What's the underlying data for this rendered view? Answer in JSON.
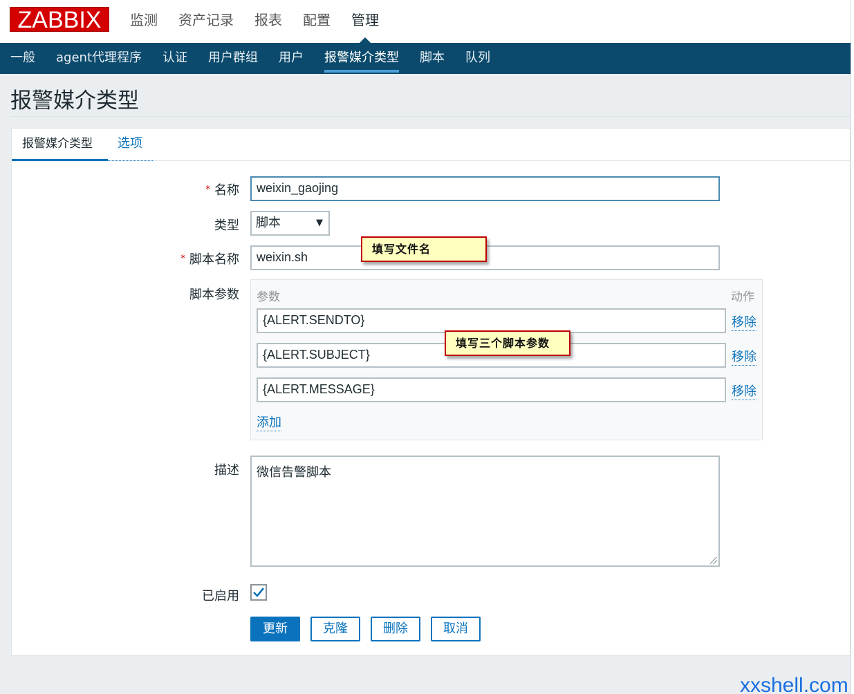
{
  "header": {
    "logo_text": "ZABBIX",
    "nav": [
      {
        "label": "监测"
      },
      {
        "label": "资产记录"
      },
      {
        "label": "报表"
      },
      {
        "label": "配置"
      },
      {
        "label": "管理",
        "active": true
      }
    ]
  },
  "subnav": [
    {
      "label": "一般"
    },
    {
      "label": "agent代理程序"
    },
    {
      "label": "认证"
    },
    {
      "label": "用户群组"
    },
    {
      "label": "用户"
    },
    {
      "label": "报警媒介类型",
      "active": true
    },
    {
      "label": "脚本"
    },
    {
      "label": "队列"
    }
  ],
  "page": {
    "title": "报警媒介类型"
  },
  "tabs": [
    {
      "label": "报警媒介类型",
      "active": true
    },
    {
      "label": "选项"
    }
  ],
  "form": {
    "name": {
      "label": "名称",
      "required_mark": "*",
      "value": "weixin_gaojing"
    },
    "type": {
      "label": "类型",
      "value": "脚本",
      "caret": "▼"
    },
    "script_name": {
      "label": "脚本名称",
      "required_mark": "*",
      "value": "weixin.sh"
    },
    "script_params": {
      "label": "脚本参数",
      "col_param": "参数",
      "col_action": "动作",
      "rows": [
        {
          "value": "{ALERT.SENDTO}",
          "remove": "移除"
        },
        {
          "value": "{ALERT.SUBJECT}",
          "remove": "移除"
        },
        {
          "value": "{ALERT.MESSAGE}",
          "remove": "移除"
        }
      ],
      "add": "添加"
    },
    "description": {
      "label": "描述",
      "value": "微信告警脚本"
    },
    "enabled": {
      "label": "已启用",
      "checked": true
    }
  },
  "buttons": {
    "update": "更新",
    "clone": "克隆",
    "delete": "删除",
    "cancel": "取消"
  },
  "annotations": {
    "file_name": "填写文件名",
    "three_params": "填写三个脚本参数"
  },
  "watermark": "xxshell.com",
  "colors": {
    "brand_red": "#d40000",
    "nav_blue": "#0b4a6c",
    "link_blue": "#0a73bd",
    "callout_bg": "#ffffc0",
    "callout_border": "#c00000"
  }
}
